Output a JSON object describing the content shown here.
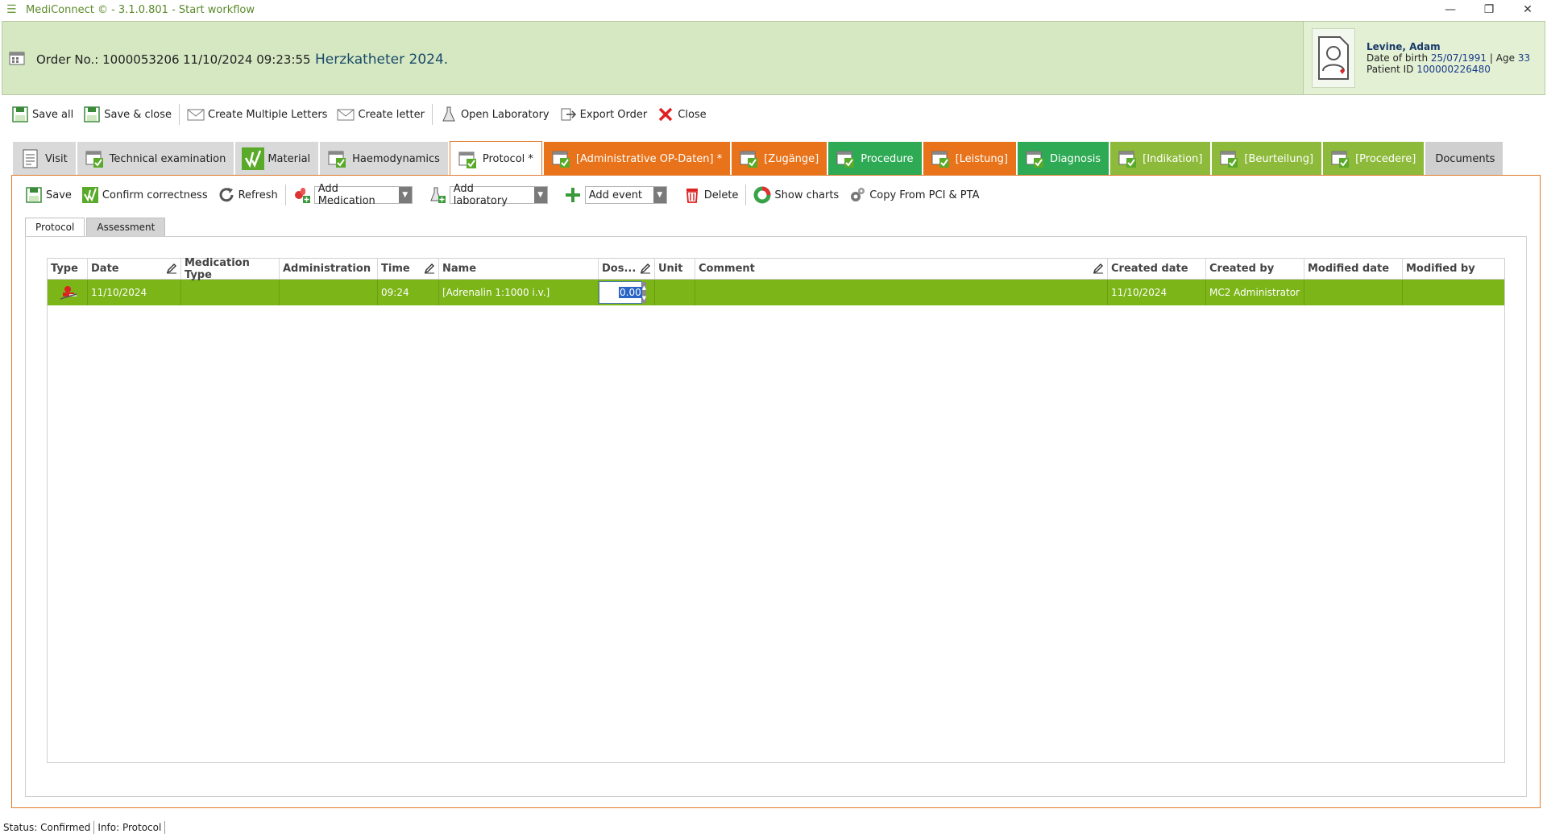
{
  "window": {
    "title": "MediConnect © - 3.1.0.801 - Start workflow",
    "minimize": "—",
    "restore": "❐",
    "close": "✕"
  },
  "header": {
    "order_label": "Order No.: 1000053206",
    "order_datetime": "11/10/2024 09:23:55",
    "order_title": "Herzkatheter 2024.",
    "patient": {
      "name": "Levine, Adam",
      "dob_label": "Date of birth",
      "dob": "25/07/1991",
      "age_label": "| Age",
      "age": "33",
      "pid_label": "Patient ID",
      "pid": "100000226480"
    }
  },
  "toolbar": {
    "save_all": "Save all",
    "save_close": "Save & close",
    "create_multiple_letters": "Create Multiple Letters",
    "create_letter": "Create letter",
    "open_laboratory": "Open Laboratory",
    "export_order": "Export Order",
    "close": "Close"
  },
  "tabs": [
    {
      "label": "Visit"
    },
    {
      "label": "Technical examination"
    },
    {
      "label": "Material"
    },
    {
      "label": "Haemodynamics"
    },
    {
      "label": "Protocol *"
    },
    {
      "label": "[Administrative OP-Daten] *"
    },
    {
      "label": "[Zugänge]"
    },
    {
      "label": "Procedure"
    },
    {
      "label": "[Leistung]"
    },
    {
      "label": "Diagnosis"
    },
    {
      "label": "[Indikation]"
    },
    {
      "label": "[Beurteilung]"
    },
    {
      "label": "[Procedere]"
    },
    {
      "label": "Documents"
    }
  ],
  "inner_toolbar": {
    "save": "Save",
    "confirm": "Confirm correctness",
    "refresh": "Refresh",
    "add_medication": "Add Medication",
    "add_laboratory": "Add laboratory",
    "add_event": "Add event",
    "delete": "Delete",
    "show_charts": "Show charts",
    "copy_from": "Copy From PCI & PTA"
  },
  "subtabs": [
    "Protocol",
    "Assessment"
  ],
  "grid": {
    "columns": [
      "Type",
      "Date",
      "Medication Type",
      "Administration",
      "Time",
      "Name",
      "Dos...",
      "Unit",
      "Comment",
      "Created date",
      "Created by",
      "Modified date",
      "Modified by"
    ],
    "rows": [
      {
        "date": "11/10/2024",
        "medication_type": "",
        "administration": "",
        "time": "09:24",
        "name": "[Adrenalin 1:1000 i.v.]",
        "dose": "0.00",
        "unit": "",
        "comment": "",
        "created_date": "11/10/2024",
        "created_by": "MC2 Administrator",
        "modified_date": "",
        "modified_by": ""
      }
    ]
  },
  "status": {
    "status": "Status: Confirmed",
    "info": "Info: Protocol"
  }
}
